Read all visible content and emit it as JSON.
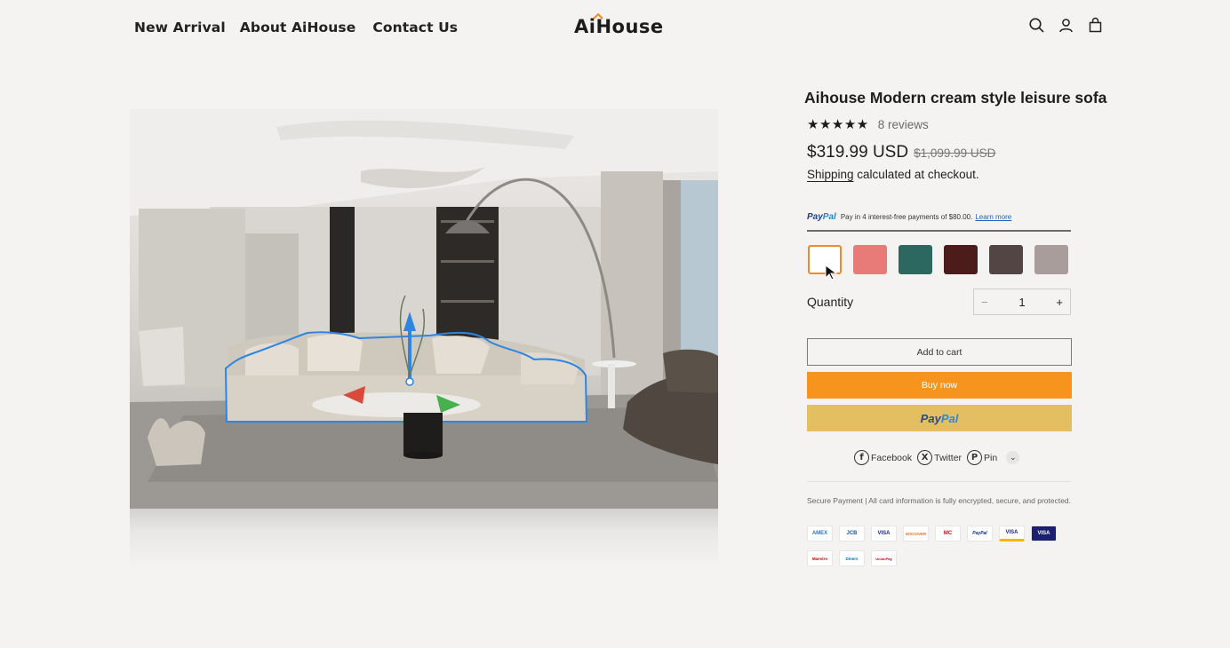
{
  "header": {
    "nav": [
      "New Arrival",
      "About AiHouse",
      "Contact Us"
    ],
    "logo": "AiHouse",
    "icons": [
      "search-icon",
      "account-icon",
      "cart-icon"
    ]
  },
  "product": {
    "title": "Aihouse Modern cream style leisure sofa",
    "stars": "★★★★★",
    "reviews": "8 reviews",
    "price": "$319.99 USD",
    "compare_price": "$1,099.99 USD",
    "shipping_link": "Shipping",
    "shipping_rest": " calculated at checkout.",
    "paypal_message": {
      "brand_a": "Pay",
      "brand_b": "Pal",
      "text": "Pay in 4 interest-free payments of $80.00.",
      "link": "Learn more"
    },
    "swatches": [
      "#ffffff",
      "#e87b78",
      "#2d6860",
      "#4b1c1a",
      "#524543",
      "#a89d9b"
    ],
    "selected_swatch": 0,
    "quantity_label": "Quantity",
    "quantity": "1",
    "minus": "−",
    "plus": "+",
    "add_to_cart": "Add to cart",
    "buy_now": "Buy now",
    "paypal_button_a": "Pay",
    "paypal_button_b": "Pal",
    "share": {
      "facebook": "Facebook",
      "twitter": "Twitter",
      "pin": "Pin"
    },
    "secure_text": "Secure Payment | All card information is fully encrypted, secure, and protected.",
    "cards": [
      "AMEX",
      "JCB",
      "VISA",
      "DISCOVER",
      "MC",
      "PayPal",
      "VISA",
      "VISA",
      "Maestro",
      "Diners",
      "UnionPay"
    ]
  },
  "colors": {
    "accent_orange": "#f7941d",
    "paypal_yellow": "#e4bf61",
    "selection_blue": "#2f86e0",
    "background": "#f4f3f2"
  }
}
